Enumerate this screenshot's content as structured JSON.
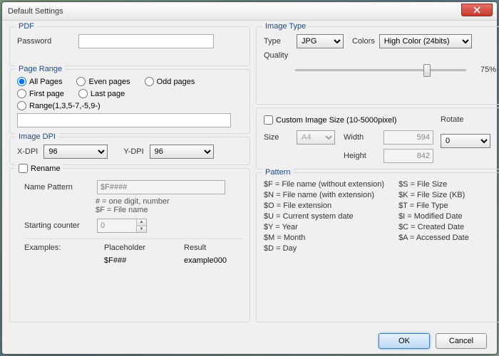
{
  "title": "Default Settings",
  "pdf": {
    "legend": "PDF",
    "password_label": "Password",
    "password_value": ""
  },
  "page_range": {
    "legend": "Page Range",
    "all": "All Pages",
    "even": "Even pages",
    "odd": "Odd pages",
    "first": "First page",
    "last": "Last page",
    "range_label": "Range(1,3,5-7,-5,9-)",
    "range_value": ""
  },
  "image_dpi": {
    "legend": "Image DPI",
    "x_label": "X-DPI",
    "x_value": "96",
    "y_label": "Y-DPI",
    "y_value": "96"
  },
  "rename": {
    "check_label": "Rename",
    "pattern_label": "Name Pattern",
    "pattern_placeholder": "$F####",
    "hint1": "# = one digit, number",
    "hint2": "$F = File name",
    "start_label": "Starting counter",
    "start_value": "0",
    "examples_label": "Examples:",
    "col_placeholder": "Placeholder",
    "col_result": "Result",
    "ex_ph": "$F###",
    "ex_res": "example000"
  },
  "image_type": {
    "legend": "Image Type",
    "type_label": "Type",
    "type_value": "JPG",
    "colors_label": "Colors",
    "colors_value": "High Color (24bits)",
    "quality_label": "Quality",
    "quality_pct": "75%"
  },
  "custom_size": {
    "check_label": "Custom Image Size (10-5000pixel)",
    "size_label": "Size",
    "size_value": "A4",
    "width_label": "Width",
    "width_value": "594",
    "height_label": "Height",
    "height_value": "842",
    "rotate_label": "Rotate",
    "rotate_value": "0"
  },
  "pattern_legend": {
    "legend": "Pattern",
    "f": "$F = File name (without extension)",
    "n": "$N = File name (with extension)",
    "o": "$O = File extension",
    "u": "$U = Current system date",
    "y": "$Y = Year",
    "m": "$M = Month",
    "d": "$D = Day",
    "s": "$S = File Size",
    "k": "$K = File Size (KB)",
    "t": "$T = File Type",
    "i": "$I = Modified Date",
    "c": "$C = Created Date",
    "a": "$A = Accessed Date"
  },
  "buttons": {
    "ok": "OK",
    "cancel": "Cancel"
  }
}
